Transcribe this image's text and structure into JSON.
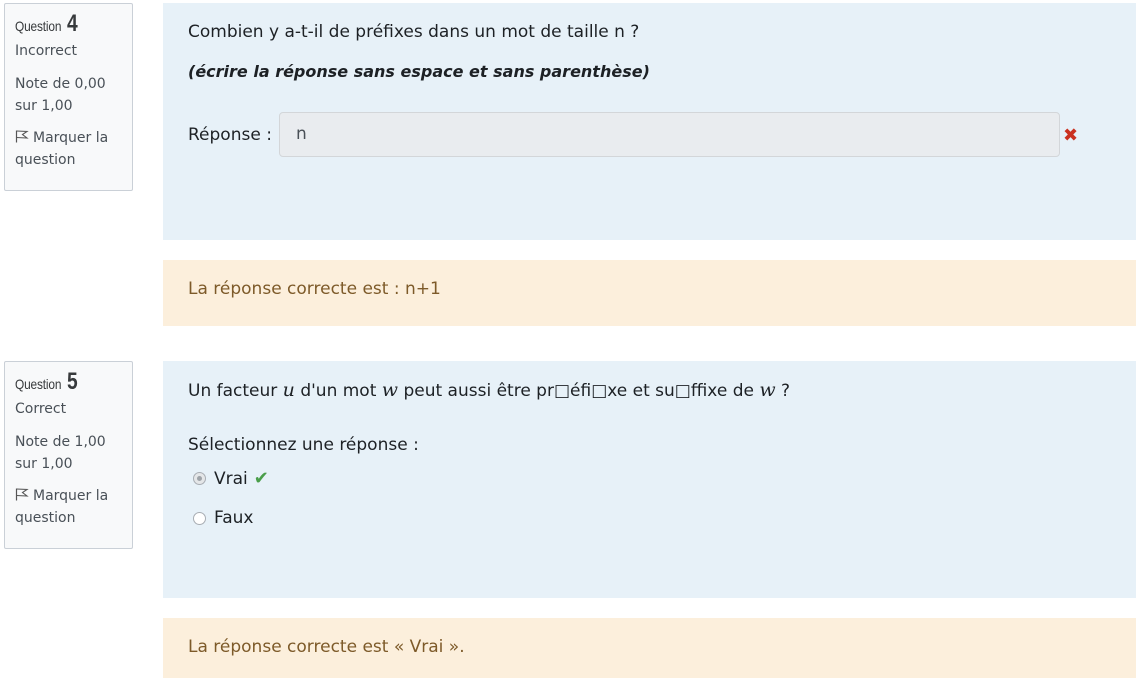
{
  "questions": [
    {
      "info": {
        "question_word": "Question",
        "number": "4",
        "state": "Incorrect",
        "grade_line1": "Note de 0,00",
        "grade_line2": "sur 1,00",
        "flag_line1": "Marquer la",
        "flag_line2": "question"
      },
      "text": "Combien y a-t-il de préfixes dans un mot de taille n ?",
      "note": "(écrire la réponse sans espace et sans parenthèse)",
      "answer_label": "Réponse :",
      "answer_value": "n",
      "result_icon": "cross-icon",
      "feedback": "La réponse correcte est : n+1"
    },
    {
      "info": {
        "question_word": "Question",
        "number": "5",
        "state": "Correct",
        "grade_line1": "Note de 1,00",
        "grade_line2": "sur 1,00",
        "flag_line1": "Marquer la",
        "flag_line2": "question"
      },
      "text_parts": {
        "p1": "Un facteur ",
        "var_u": "u",
        "p2": " d'un mot ",
        "var_w": "w",
        "p3": " peut aussi être pr□éfi□xe et su□ffixe de ",
        "var_w2": "w",
        "p4": " ?"
      },
      "prompt": "Sélectionnez une réponse :",
      "options": [
        {
          "label": "Vrai",
          "selected": true,
          "result_icon": "check-icon"
        },
        {
          "label": "Faux",
          "selected": false
        }
      ],
      "feedback": "La réponse correcte est « Vrai »."
    }
  ],
  "colors": {
    "formulation_bg": "#e7f1f8",
    "feedback_bg": "#fcefdc",
    "feedback_text": "#7d5a29",
    "incorrect": "#ca3120",
    "correct": "#4a9e4a"
  }
}
